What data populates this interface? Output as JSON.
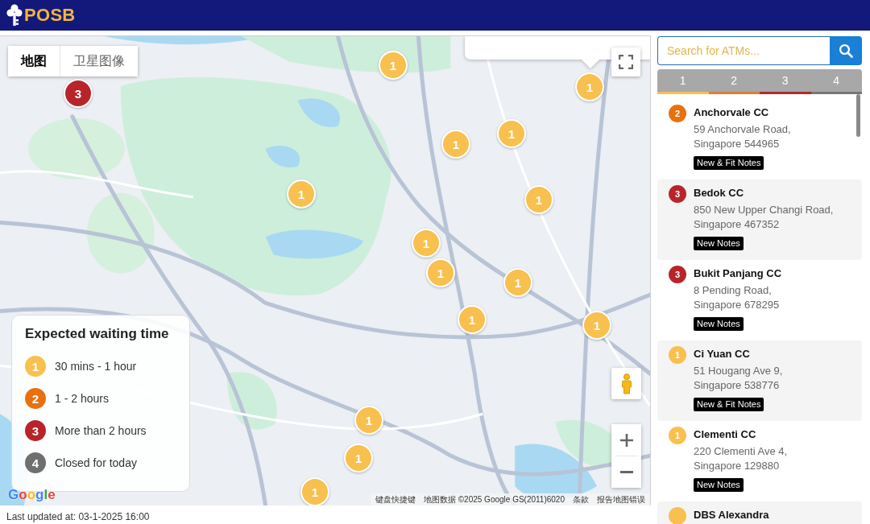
{
  "header": {
    "brand": "POSB"
  },
  "map": {
    "type_toggle": [
      {
        "label": "地图",
        "selected": true
      },
      {
        "label": "卫星图像",
        "selected": false
      }
    ],
    "markers": [
      {
        "count": "3",
        "color": "#b7252b"
      },
      {
        "count": "1",
        "color": "#f8c04e"
      },
      {
        "count": "1",
        "color": "#f8c04e"
      },
      {
        "count": "1",
        "color": "#f8c04e"
      },
      {
        "count": "1",
        "color": "#f8c04e"
      },
      {
        "count": "1",
        "color": "#f8c04e"
      },
      {
        "count": "1",
        "color": "#f8c04e"
      },
      {
        "count": "1",
        "color": "#f8c04e"
      },
      {
        "count": "1",
        "color": "#f8c04e"
      },
      {
        "count": "1",
        "color": "#f8c04e"
      },
      {
        "count": "1",
        "color": "#f8c04e"
      },
      {
        "count": "1",
        "color": "#f8c04e"
      },
      {
        "count": "1",
        "color": "#f8c04e"
      },
      {
        "count": "1",
        "color": "#f8c04e"
      },
      {
        "count": "1",
        "color": "#f8c04e"
      }
    ],
    "legend": {
      "title": "Expected waiting time",
      "items": [
        {
          "count": "1",
          "color": "#f8c04e",
          "label": "30 mins - 1 hour"
        },
        {
          "count": "2",
          "color": "#e8710f",
          "label": "1 - 2 hours"
        },
        {
          "count": "3",
          "color": "#b7252b",
          "label": "More than 2 hours"
        },
        {
          "count": "4",
          "color": "#6f6f6f",
          "label": "Closed for today"
        }
      ]
    },
    "google_logo": "Google",
    "attribution": {
      "shortcuts": "键盘快捷键",
      "map_data": "地图数据 ©2025 Google GS(2011)6020",
      "terms": "条款",
      "report": "报告地图错误"
    }
  },
  "last_updated": "Last updated at: 03-1-2025 16:00",
  "sidebar": {
    "search": {
      "placeholder": "Search for ATMs..."
    },
    "tabs": [
      {
        "label": "1",
        "color": "#f8c04e"
      },
      {
        "label": "2",
        "color": "#e07b39"
      },
      {
        "label": "3",
        "color": "#b22a2a"
      },
      {
        "label": "4",
        "color": "#777777"
      }
    ],
    "atms": [
      {
        "count": "2",
        "color": "#e8710f",
        "name": "Anchorvale CC",
        "address_lines": [
          "59 Anchorvale Road,",
          "Singapore 544965"
        ],
        "notes": "New & Fit Notes"
      },
      {
        "count": "3",
        "color": "#b7252b",
        "name": "Bedok CC",
        "address_lines": [
          "850 New Upper Changi Road,",
          "Singapore 467352"
        ],
        "notes": "New Notes"
      },
      {
        "count": "3",
        "color": "#b7252b",
        "name": "Bukit Panjang CC",
        "address_lines": [
          "8 Pending Road,",
          "Singapore 678295"
        ],
        "notes": "New Notes"
      },
      {
        "count": "1",
        "color": "#f8c04e",
        "name": "Ci Yuan CC",
        "address_lines": [
          "51 Hougang Ave 9,",
          "Singapore 538776"
        ],
        "notes": "New & Fit Notes"
      },
      {
        "count": "1",
        "color": "#f8c04e",
        "name": "Clementi CC",
        "address_lines": [
          "220 Clementi Ave 4,",
          "Singapore 129880"
        ],
        "notes": "New Notes"
      },
      {
        "color": "#f8c04e",
        "name": "DBS Alexandra"
      }
    ]
  }
}
